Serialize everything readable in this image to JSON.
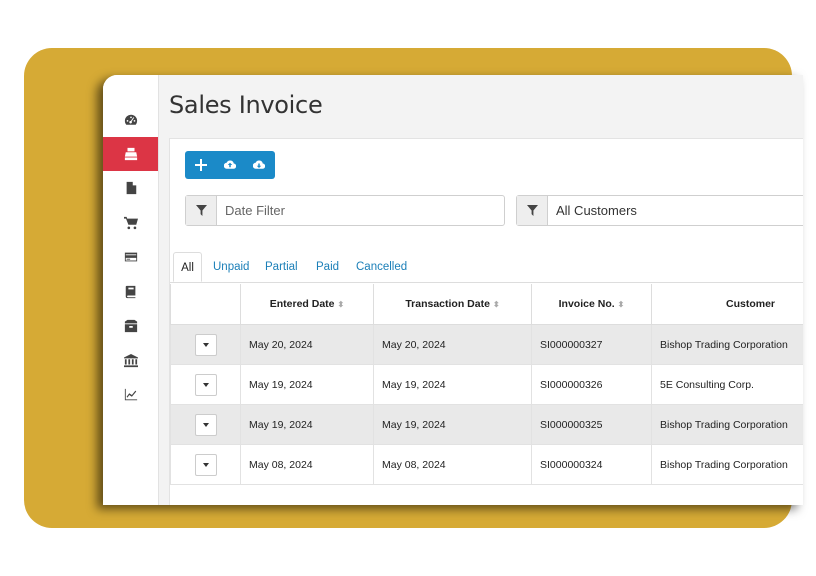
{
  "page": {
    "title": "Sales Invoice"
  },
  "colors": {
    "background_card": "#d6aa35",
    "accent": "#1b8ac8",
    "active_nav": "#dc3545"
  },
  "sidebar": {
    "items": [
      {
        "icon": "dashboard-icon",
        "active": false
      },
      {
        "icon": "cash-register-icon",
        "active": true
      },
      {
        "icon": "document-icon",
        "active": false
      },
      {
        "icon": "cart-icon",
        "active": false
      },
      {
        "icon": "credit-card-icon",
        "active": false
      },
      {
        "icon": "book-icon",
        "active": false
      },
      {
        "icon": "box-icon",
        "active": false
      },
      {
        "icon": "bank-icon",
        "active": false
      },
      {
        "icon": "chart-icon",
        "active": false
      }
    ]
  },
  "toolbar": {
    "buttons": [
      {
        "icon": "plus-icon",
        "label": "+"
      },
      {
        "icon": "cloud-upload-icon"
      },
      {
        "icon": "cloud-download-icon"
      }
    ]
  },
  "filters": {
    "date": {
      "placeholder": "Date Filter",
      "value": ""
    },
    "customer": {
      "value": "All Customers"
    }
  },
  "tabs": [
    "All",
    "Unpaid",
    "Partial",
    "Paid",
    "Cancelled"
  ],
  "active_tab": "All",
  "table": {
    "columns": [
      "",
      "Entered Date",
      "Transaction Date",
      "Invoice No.",
      "Customer"
    ],
    "rows": [
      {
        "entered": "May 20, 2024",
        "transaction": "May 20, 2024",
        "invoice": "SI000000327",
        "customer": "Bishop Trading Corporation"
      },
      {
        "entered": "May 19, 2024",
        "transaction": "May 19, 2024",
        "invoice": "SI000000326",
        "customer": "5E Consulting Corp."
      },
      {
        "entered": "May 19, 2024",
        "transaction": "May 19, 2024",
        "invoice": "SI000000325",
        "customer": "Bishop Trading Corporation"
      },
      {
        "entered": "May 08, 2024",
        "transaction": "May 08, 2024",
        "invoice": "SI000000324",
        "customer": "Bishop Trading Corporation"
      }
    ]
  }
}
